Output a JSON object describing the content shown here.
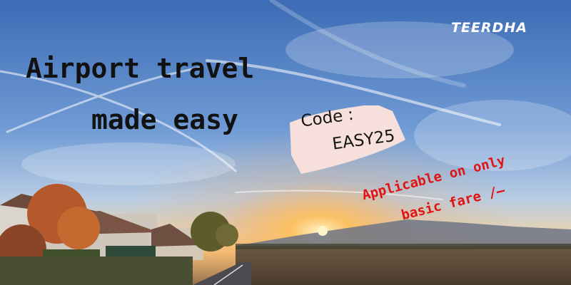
{
  "brand": {
    "name": "TEERDHA"
  },
  "headline": {
    "line1": "Airport travel",
    "line2": "made easy"
  },
  "promo": {
    "code_label": "Code :",
    "code_value": "EASY25"
  },
  "note": {
    "line1": "Applicable on only",
    "line2": "basic fare /–"
  },
  "colors": {
    "headline_text": "#121212",
    "note_text": "#e01414",
    "code_card": "#f7dfdb",
    "brand_text": "#ffffff",
    "sky_top": "#3f6fb8",
    "sun": "#ffb347"
  }
}
